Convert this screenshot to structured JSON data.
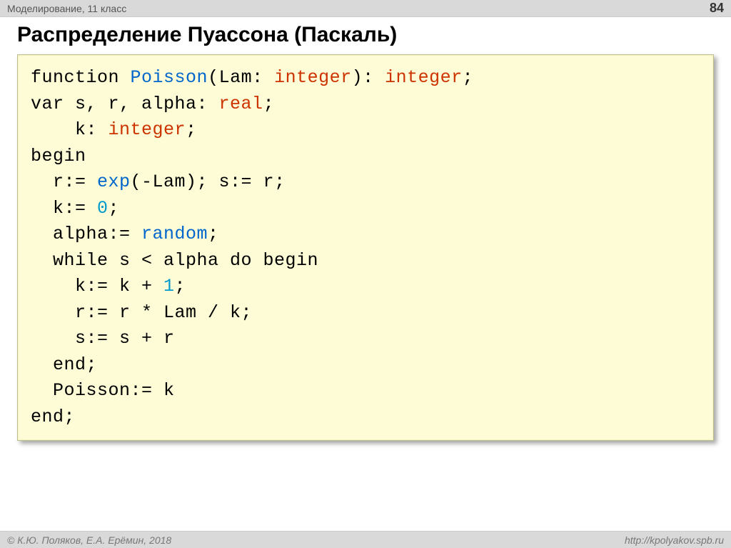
{
  "header": {
    "course": "Моделирование, 11 класс",
    "page": "84"
  },
  "title": "Распределение Пуассона (Паскаль)",
  "code": {
    "l1a": "function ",
    "l1b": "Poisson",
    "l1c": "(Lam: ",
    "l1d": "integer",
    "l1e": "): ",
    "l1f": "integer",
    "l1g": ";",
    "l2a": "var s, r, alpha: ",
    "l2b": "real",
    "l2c": ";",
    "l3a": "    k: ",
    "l3b": "integer",
    "l3c": ";",
    "l4": "begin",
    "l5a": "  r:= ",
    "l5b": "exp",
    "l5c": "(-Lam); s:= r;",
    "l6a": "  k:= ",
    "l6b": "0",
    "l6c": ";",
    "l7a": "  alpha:= ",
    "l7b": "random",
    "l7c": ";",
    "l8": "  while s < alpha do begin",
    "l9a": "    k:= k + ",
    "l9b": "1",
    "l9c": ";",
    "l10": "    r:= r * Lam / k;",
    "l11": "    s:= s + r",
    "l12": "  end;",
    "l13": "  Poisson:= k",
    "l14": "end;"
  },
  "footer": {
    "left": "© К.Ю. Поляков, Е.А. Ерёмин, 2018",
    "right": "http://kpolyakov.spb.ru"
  }
}
